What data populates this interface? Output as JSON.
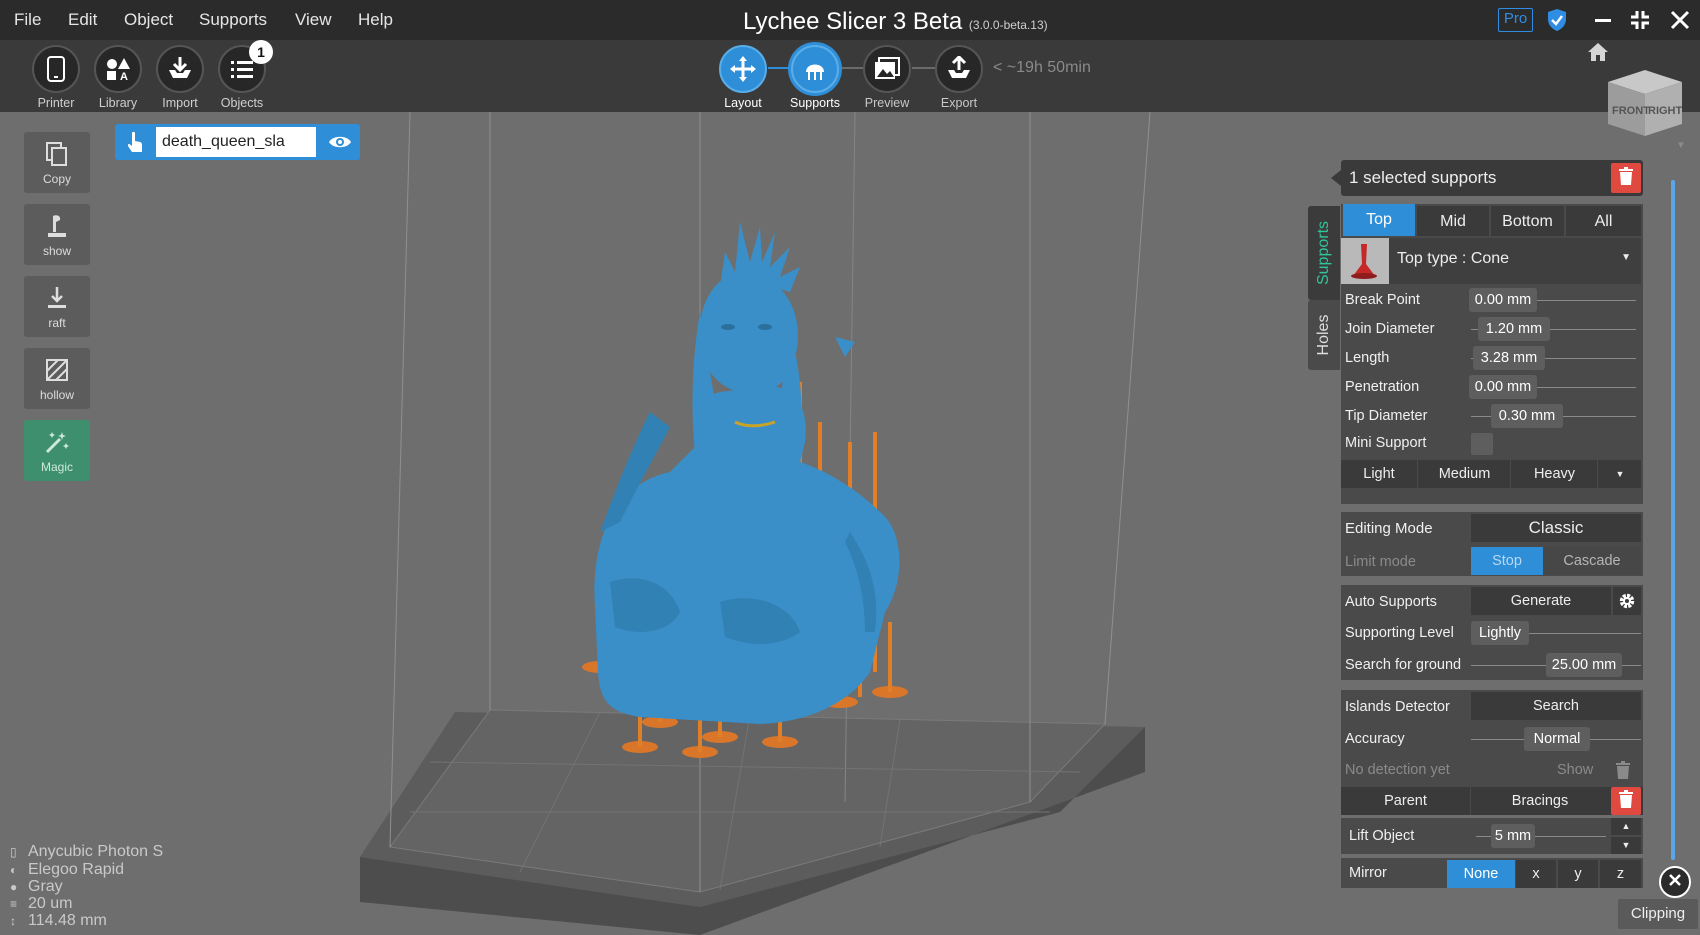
{
  "menu": [
    "File",
    "Edit",
    "Object",
    "Supports",
    "View",
    "Help"
  ],
  "app": {
    "title": "Lychee Slicer 3 Beta",
    "version": "(3.0.0-beta.13)",
    "pro": "Pro"
  },
  "toolbar": {
    "tools": [
      "Printer",
      "Library",
      "Import",
      "Objects"
    ],
    "objects_count": "1",
    "steps": [
      "Layout",
      "Supports",
      "Preview",
      "Export"
    ],
    "active_step": "Supports",
    "time_estimate": "~19h 50min"
  },
  "object": {
    "name": "death_queen_sla"
  },
  "left_tools": [
    "Copy",
    "show",
    "raft",
    "hollow",
    "Magic"
  ],
  "printer_info": [
    "Anycubic Photon S",
    "Elegoo Rapid",
    "Gray",
    "20 um",
    "114.48 mm"
  ],
  "navcube": {
    "front": "FRONT",
    "right": "RIGHT"
  },
  "side_tabs": [
    "Supports",
    "Holes"
  ],
  "panel": {
    "header": "1 selected supports",
    "tabs": [
      "Top",
      "Mid",
      "Bottom",
      "All"
    ],
    "active_tab": "Top",
    "top_type": "Top type : Cone",
    "params": [
      {
        "label": "Break Point",
        "value": "0.00 mm",
        "level": 0.0
      },
      {
        "label": "Join Diameter",
        "value": "1.20 mm",
        "level": 0.12
      },
      {
        "label": "Length",
        "value": "3.28 mm",
        "level": 0.03
      },
      {
        "label": "Penetration",
        "value": "0.00 mm",
        "level": 0.0
      },
      {
        "label": "Tip Diameter",
        "value": "0.30 mm",
        "level": 0.13
      }
    ],
    "mini_support": "Mini Support",
    "presets": [
      "Light",
      "Medium",
      "Heavy"
    ],
    "editing_mode": {
      "label": "Editing Mode",
      "value": "Classic"
    },
    "limit_mode": {
      "label": "Limit mode",
      "stop": "Stop",
      "cascade": "Cascade"
    },
    "auto_supports": {
      "label": "Auto Supports",
      "button": "Generate"
    },
    "supporting_level": {
      "label": "Supporting Level",
      "value": "Lightly"
    },
    "search_ground": {
      "label": "Search for ground",
      "value": "25.00 mm"
    },
    "islands": {
      "label": "Islands Detector",
      "button": "Search"
    },
    "accuracy": {
      "label": "Accuracy",
      "value": "Normal"
    },
    "no_detection": {
      "label": "No detection yet",
      "show": "Show"
    },
    "parent_row": {
      "parent": "Parent",
      "bracings": "Bracings"
    },
    "lift": {
      "label": "Lift Object",
      "value": "5 mm"
    },
    "mirror": {
      "label": "Mirror",
      "options": [
        "None",
        "x",
        "y",
        "z"
      ],
      "active": "None"
    }
  },
  "clipping": "Clipping",
  "colors": {
    "accent": "#2e8ed8",
    "model": "#3c8fc7",
    "supports": "#e07f28",
    "delete": "#e0493f"
  }
}
